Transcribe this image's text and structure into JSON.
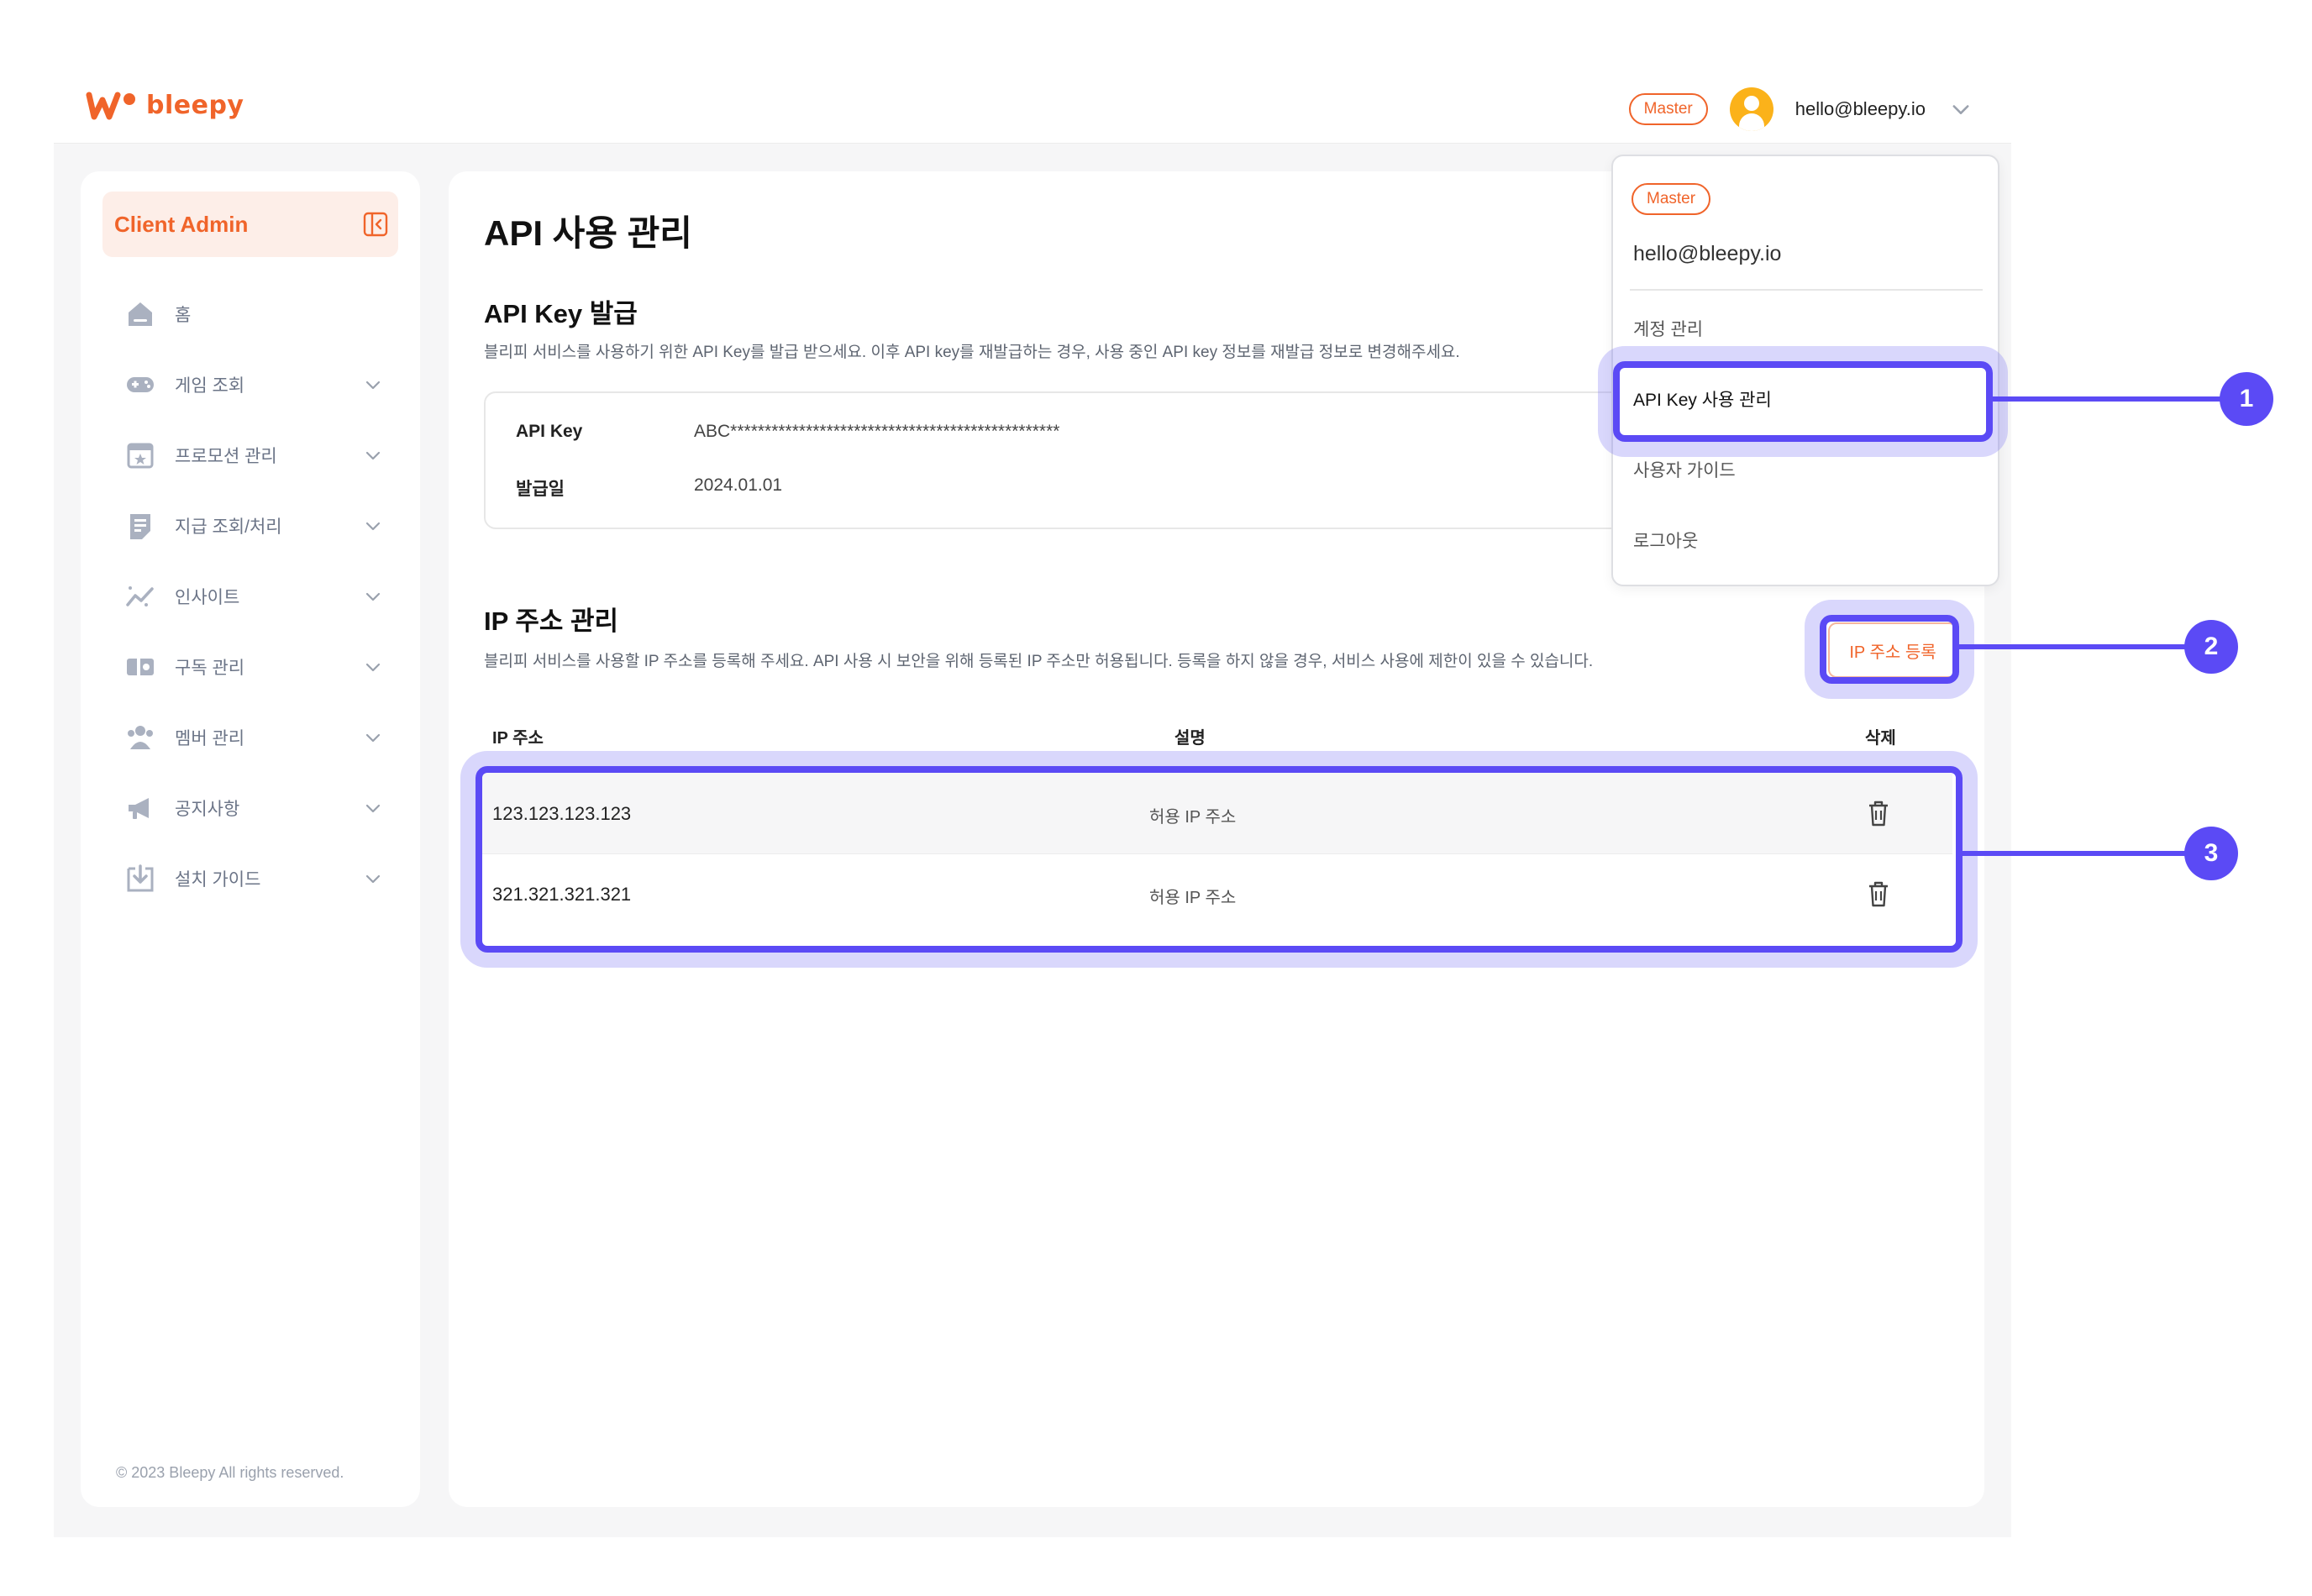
{
  "brand": {
    "name": "bleepy",
    "color": "#f0642a"
  },
  "header": {
    "role_badge": "Master",
    "email": "hello@bleepy.io"
  },
  "sidebar": {
    "title": "Client Admin",
    "items": [
      {
        "label": "홈",
        "icon": "home-icon"
      },
      {
        "label": "게임 조회",
        "icon": "gamepad-icon"
      },
      {
        "label": "프로모션 관리",
        "icon": "promotion-calendar-icon"
      },
      {
        "label": "지급 조회/처리",
        "icon": "payout-document-icon"
      },
      {
        "label": "인사이트",
        "icon": "insight-chart-icon"
      },
      {
        "label": "구독 관리",
        "icon": "subscription-icon"
      },
      {
        "label": "멤버 관리",
        "icon": "members-icon"
      },
      {
        "label": "공지사항",
        "icon": "megaphone-icon"
      },
      {
        "label": "설치 가이드",
        "icon": "install-download-icon"
      }
    ],
    "copyright": "© 2023 Bleepy All rights reserved."
  },
  "main": {
    "title": "API 사용 관리",
    "api_key_section": {
      "title": "API Key 발급",
      "description": "블리피 서비스를 사용하기 위한 API Key를 발급 받으세요. 이후 API key를 재발급하는 경우, 사용 중인 API key 정보를 재발급 정보로 변경해주세요.",
      "key_label": "API Key",
      "key_value": "ABC************************************************",
      "date_label": "발급일",
      "date_value": "2024.01.01"
    },
    "ip_section": {
      "title": "IP 주소 관리",
      "description": "블리피 서비스를 사용할 IP 주소를 등록해 주세요. API 사용 시 보안을 위해 등록된 IP 주소만 허용됩니다. 등록을 하지 않을 경우, 서비스 사용에 제한이 있을 수 있습니다.",
      "register_button": "IP 주소 등록",
      "columns": {
        "ip": "IP 주소",
        "description": "설명",
        "delete": "삭제"
      },
      "rows": [
        {
          "ip": "123.123.123.123",
          "description": "허용 IP 주소"
        },
        {
          "ip": "321.321.321.321",
          "description": "허용 IP 주소"
        }
      ]
    }
  },
  "dropdown": {
    "role_badge": "Master",
    "email": "hello@bleepy.io",
    "items": [
      "계정 관리",
      "API Key 사용 관리",
      "사용자 가이드",
      "로그아웃"
    ]
  },
  "callouts": [
    "1",
    "2",
    "3"
  ],
  "highlight_color": "#5b4af5"
}
